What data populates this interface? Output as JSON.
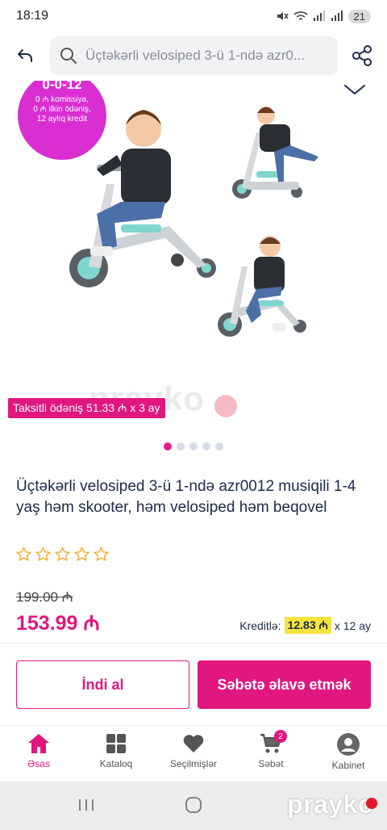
{
  "status_bar": {
    "time": "18:19",
    "battery": "21"
  },
  "search": {
    "value": "Üçtəkərli velosiped 3-ü 1-ndə azr0..."
  },
  "gallery": {
    "promo_headline": "0-0-12",
    "promo_line1": "0 ₼ komissiya,",
    "promo_line2": "0 ₼ ilkin ödəniş,",
    "promo_line3": "12 aylıq kredit",
    "installment_tag": "Taksitli ödəniş 51.33 ₼ x 3 ay",
    "watermark": "prayko",
    "slide_count": 5,
    "active_slide": 0
  },
  "product": {
    "title": "Üçtəkərli velosiped 3-ü 1-ndə azr0012 musiqili 1-4 yaş həm skooter, həm velosiped həm beqovel",
    "rating": 0,
    "old_price": "199.00 ₼",
    "new_price": "153.99 ₼",
    "credit_label": "Kreditlə:",
    "credit_value": "12.83 ₼",
    "credit_term": "x 12 ay"
  },
  "actions": {
    "buy_now": "İndi al",
    "add_to_cart": "Səbətə əlavə etmək"
  },
  "tabbar": {
    "items": [
      {
        "label": "Əsas",
        "icon": "home-icon"
      },
      {
        "label": "Kataloq",
        "icon": "grid-icon"
      },
      {
        "label": "Seçilmişlər",
        "icon": "heart-icon"
      },
      {
        "label": "Səbət",
        "icon": "cart-icon"
      },
      {
        "label": "Kabinet",
        "icon": "user-icon"
      }
    ],
    "cart_count": "2"
  },
  "brand": "prayko",
  "colors": {
    "accent": "#e0177e",
    "promo": "#d92fd2",
    "scooter_teal": "#7fd6cf",
    "credit_highlight": "#f6e33b"
  }
}
